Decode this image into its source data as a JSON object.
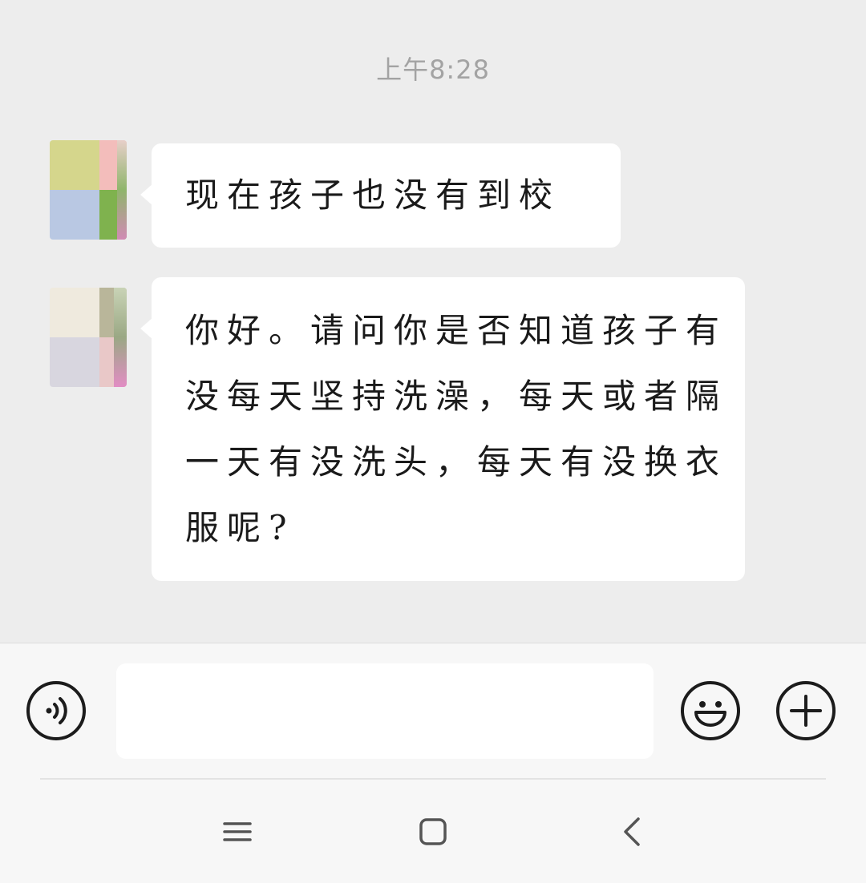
{
  "chat": {
    "timestamp": "上午8:28",
    "messages": [
      {
        "sender": "incoming",
        "text": "现在孩子也没有到校"
      },
      {
        "sender": "incoming",
        "text": "你好。请问你是否知道孩子有没每天坚持洗澡，每天或者隔一天有没洗头，每天有没换衣服呢?"
      }
    ]
  },
  "input_bar": {
    "input_value": "",
    "voice_icon": "voice-wave-icon",
    "emoji_icon": "smiley-icon",
    "plus_icon": "plus-icon"
  },
  "nav_bar": {
    "menu_icon": "menu-lines-icon",
    "home_icon": "square-home-icon",
    "back_icon": "chevron-left-icon"
  },
  "colors": {
    "chat_background": "#ededed",
    "bubble": "#ffffff",
    "timestamp": "#a3a3a3",
    "input_bar_background": "#f7f7f7",
    "icon": "#1c1c1c"
  }
}
